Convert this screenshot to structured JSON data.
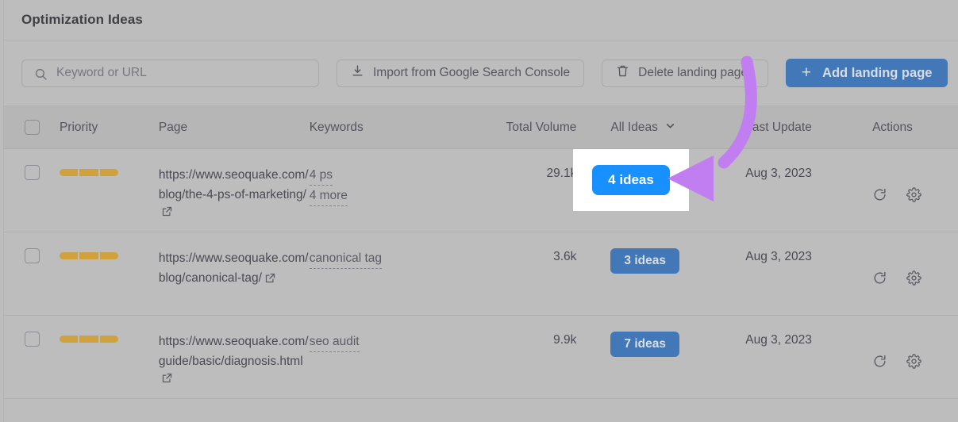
{
  "card": {
    "title": "Optimization Ideas"
  },
  "toolbar": {
    "search": {
      "placeholder": "Keyword or URL",
      "value": "",
      "icon": "search-icon"
    },
    "import_button": {
      "label": "Import from Google Search Console",
      "icon": "download-icon"
    },
    "delete_button": {
      "label": "Delete landing pages",
      "icon": "trash-icon"
    },
    "add_button": {
      "label": "Add landing page",
      "icon": "plus-icon",
      "color": "#4277b8"
    }
  },
  "table": {
    "headers": {
      "priority": "Priority",
      "page": "Page",
      "keywords": "Keywords",
      "total_volume": "Total Volume",
      "ideas_filter": "All Ideas",
      "ideas_filter_icon": "chevron-down-icon",
      "last_update": "Last Update",
      "actions": "Actions"
    },
    "rows": [
      {
        "priority_segments": 3,
        "priority_color": "#cfa23f",
        "page": "https://www.seoquake.com/blog/the-4-ps-of-marketing/",
        "keywords": [
          "4 ps",
          "4 more"
        ],
        "total_volume": "29.1k",
        "ideas": "4 ideas",
        "ideas_highlighted": true,
        "last_update": "Aug 3, 2023",
        "actions": [
          "refresh-icon",
          "gear-icon"
        ]
      },
      {
        "priority_segments": 3,
        "priority_color": "#cfa23f",
        "page": "https://www.seoquake.com/blog/canonical-tag/",
        "keywords": [
          "canonical tag"
        ],
        "total_volume": "3.6k",
        "ideas": "3 ideas",
        "ideas_highlighted": false,
        "last_update": "Aug 3, 2023",
        "actions": [
          "refresh-icon",
          "gear-icon"
        ]
      },
      {
        "priority_segments": 3,
        "priority_color": "#cfa23f",
        "page": "https://www.seoquake.com/guide/basic/diagnosis.html",
        "keywords": [
          "seo audit"
        ],
        "total_volume": "9.9k",
        "ideas": "7 ideas",
        "ideas_highlighted": false,
        "last_update": "Aug 3, 2023",
        "actions": [
          "refresh-icon",
          "gear-icon"
        ]
      }
    ]
  },
  "annotation": {
    "arrow_color": "#c07ef0",
    "highlight_target": "4 ideas",
    "highlight_box_color": "#ffffff"
  }
}
